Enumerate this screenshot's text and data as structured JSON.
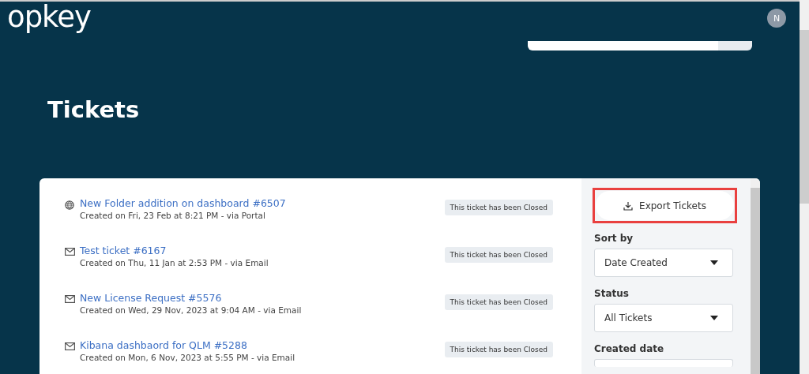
{
  "header": {
    "logo": "opkey",
    "avatar": "N"
  },
  "page_title": "Tickets",
  "tickets": [
    {
      "kind": "portal",
      "title": "New Folder addition on dashboard #6507",
      "meta": "Created on Fri, 23 Feb at 8:21 PM - via Portal",
      "status": "This ticket has been Closed"
    },
    {
      "kind": "email",
      "title": "Test ticket #6167",
      "meta": "Created on Thu, 11 Jan at 2:53 PM - via Email",
      "status": "This ticket has been Closed"
    },
    {
      "kind": "email",
      "title": "New License Request #5576",
      "meta": "Created on Wed, 29 Nov, 2023 at 9:04 AM - via Email",
      "status": "This ticket has been Closed"
    },
    {
      "kind": "email",
      "title": "Kibana dashbaord for QLM #5288",
      "meta": "Created on Mon, 6 Nov, 2023 at 5:55 PM - via Email",
      "status": "This ticket has been Closed"
    }
  ],
  "sidebar": {
    "export_button": "Export Tickets",
    "filters": [
      {
        "label": "Sort by",
        "value": "Date Created"
      },
      {
        "label": "Status",
        "value": "All Tickets"
      },
      {
        "label": "Created date"
      }
    ]
  }
}
